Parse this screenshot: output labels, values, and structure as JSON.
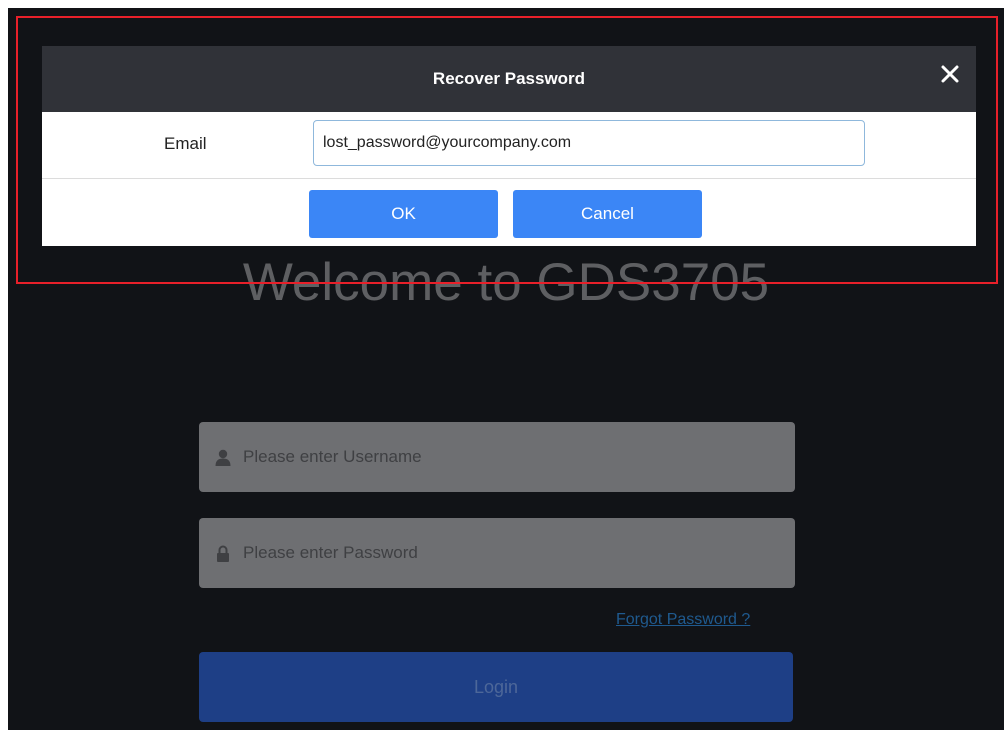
{
  "background": {
    "welcome_text": "Welcome to GDS3705"
  },
  "login_form": {
    "username_placeholder": "Please enter Username",
    "password_placeholder": "Please enter Password",
    "forgot_link": "Forgot Password ?",
    "login_label": "Login"
  },
  "dialog": {
    "title": "Recover Password",
    "email_label": "Email",
    "email_value": "lost_password@yourcompany.com",
    "ok_label": "OK",
    "cancel_label": "Cancel"
  },
  "colors": {
    "highlight_border": "#e8202a",
    "dialog_header": "#303238",
    "button_blue": "#3b86f6",
    "page_bg": "#111317"
  },
  "icons": {
    "close": "close-icon",
    "username": "user-icon",
    "password": "lock-icon"
  }
}
